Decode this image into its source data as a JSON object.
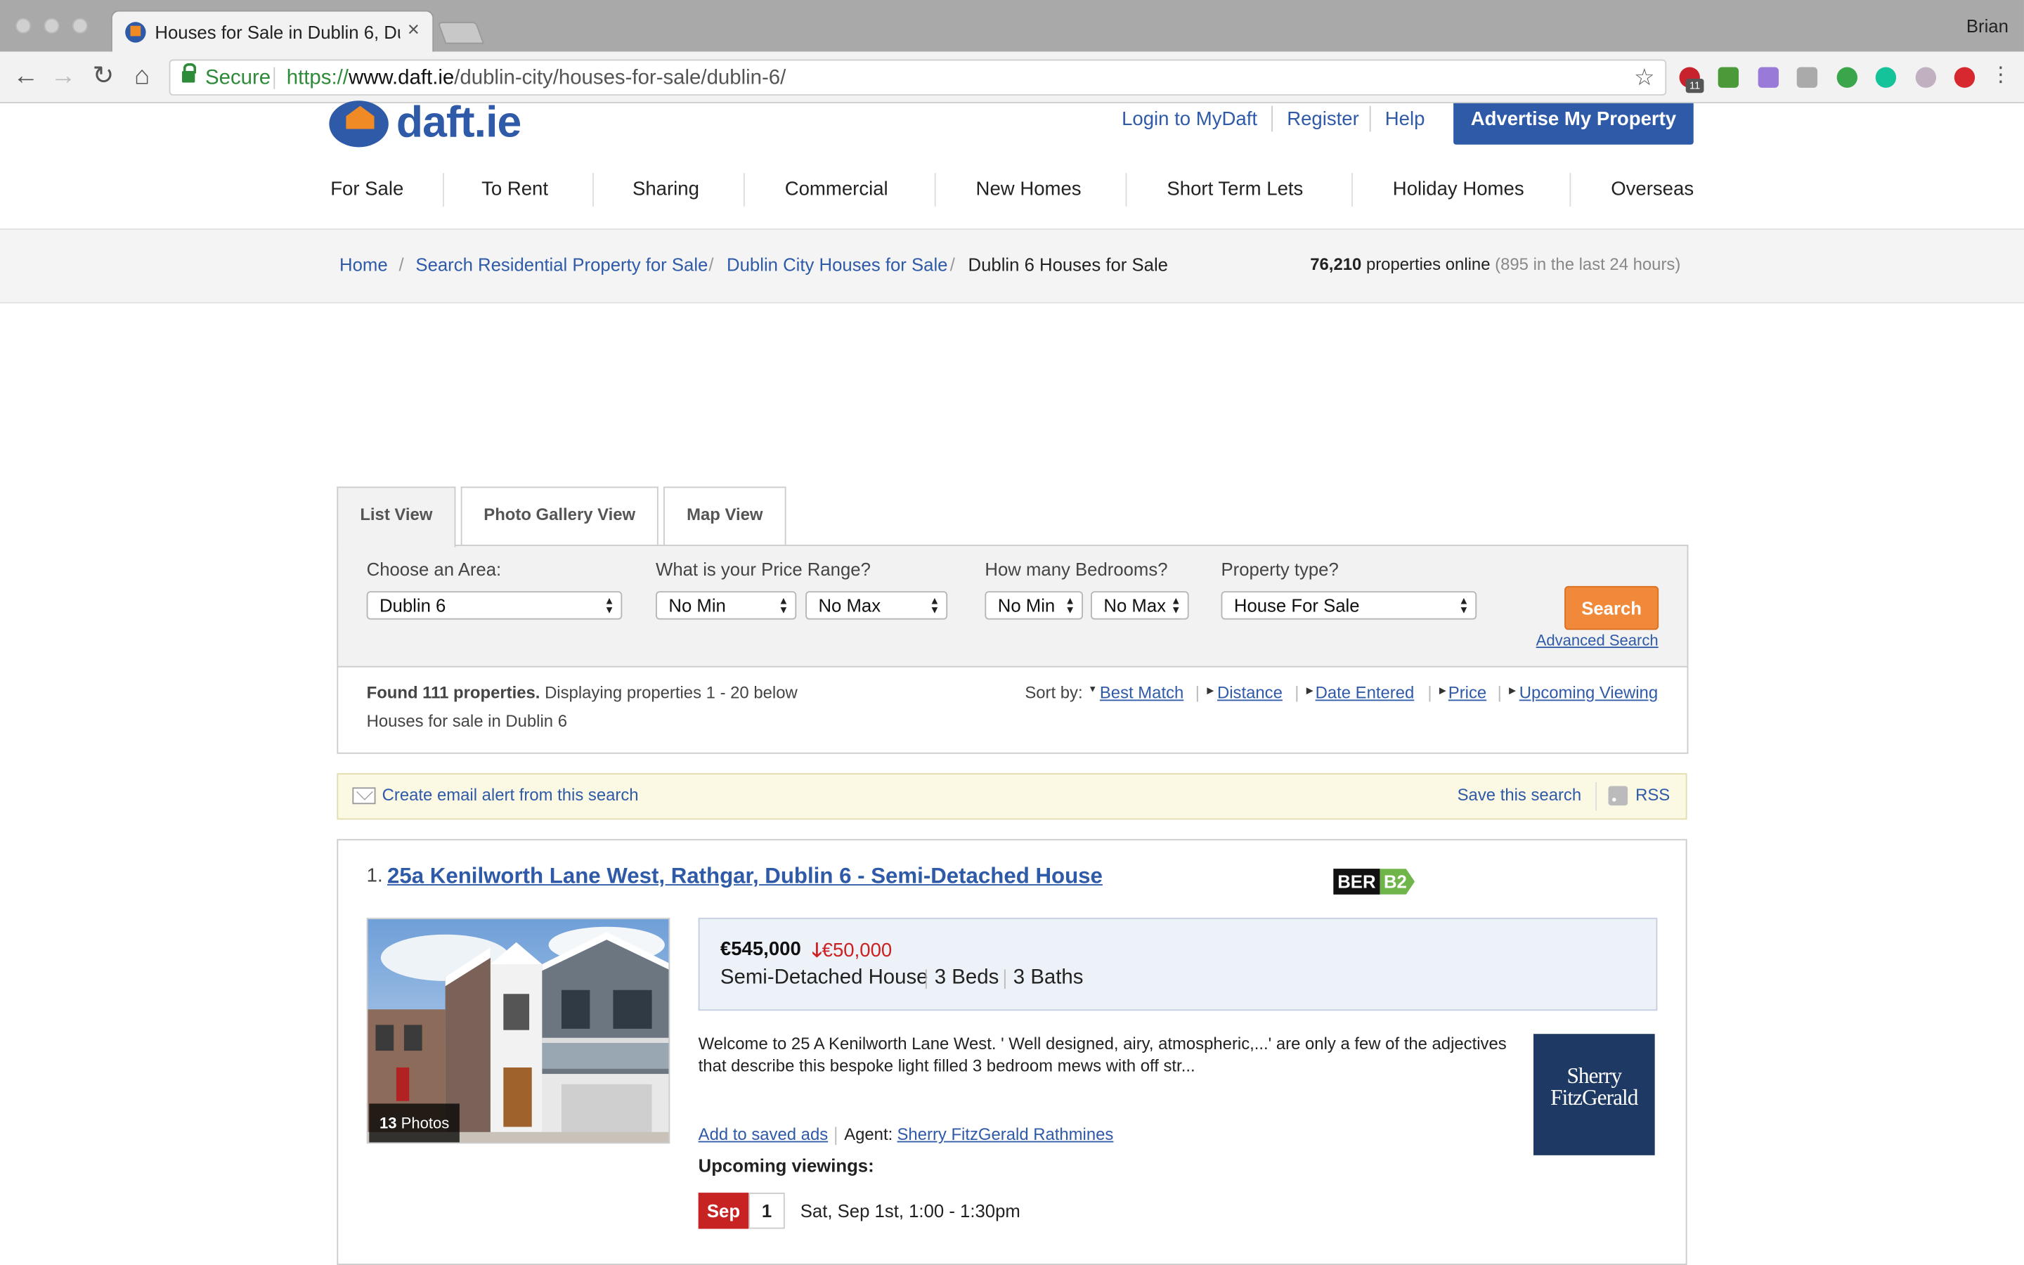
{
  "browser": {
    "tab_title": "Houses for Sale in Dublin 6, Du",
    "tab_close": "×",
    "profile_name": "Brian",
    "secure_label": "Secure",
    "url_scheme": "https://",
    "url_host": "www.daft.ie",
    "url_path": "/dublin-city/houses-for-sale/dublin-6/",
    "nav_icons": [
      "back-arrow-icon",
      "forward-arrow-icon",
      "reload-icon",
      "home-icon"
    ],
    "extension_icons": [
      "adblock-icon",
      "html-icon",
      "extension-icon",
      "pen-icon",
      "evernote-icon",
      "grammarly-icon",
      "glasses-icon",
      "shield-icon",
      "menu-dots-icon"
    ],
    "extension_badge": "11"
  },
  "header": {
    "logo_text": "daft.ie",
    "links": [
      "Login to MyDaft",
      "Register",
      "Help"
    ],
    "advertise_label": "Advertise My Property",
    "brand_color": "#2e5aa8",
    "accent_color": "#f08a24"
  },
  "main_nav": [
    "For Sale",
    "To Rent",
    "Sharing",
    "Commercial",
    "New Homes",
    "Short Term Lets",
    "Holiday Homes",
    "Overseas"
  ],
  "breadcrumb": {
    "items": [
      "Home",
      "Search Residential Property for Sale",
      "Dublin City Houses for Sale",
      "Dublin 6 Houses for Sale"
    ],
    "separator": "/"
  },
  "stats": {
    "count": "76,210",
    "count_suffix": "properties online",
    "recent": "(895 in the last 24 hours)"
  },
  "view_tabs": [
    "List View",
    "Photo Gallery View",
    "Map View"
  ],
  "search": {
    "area_label": "Choose an Area:",
    "area_value": "Dublin 6",
    "price_label": "What is your Price Range?",
    "price_min": "No Min",
    "price_max": "No Max",
    "beds_label": "How many Bedrooms?",
    "beds_min": "No Min",
    "beds_max": "No Max",
    "type_label": "Property type?",
    "type_value": "House For Sale",
    "search_button": "Search",
    "advanced_link": "Advanced Search"
  },
  "results": {
    "found_bold": "Found 111 properties.",
    "found_rest": " Displaying properties 1 - 20 below",
    "subtitle": "Houses for sale in Dublin 6",
    "sort_label": "Sort by:",
    "sort_options": [
      "Best Match",
      "Distance",
      "Date Entered",
      "Price",
      "Upcoming Viewing"
    ]
  },
  "alerts": {
    "email_alert": "Create email alert from this search",
    "save_search": "Save this search",
    "rss": "RSS"
  },
  "listing": {
    "number": "1.",
    "title": "25a Kenilworth Lane West, Rathgar, Dublin 6 - Semi-Detached House",
    "ber_label": "BER",
    "ber_grade": "B2",
    "photo_count_num": "13",
    "photo_count_label": " Photos",
    "price": "€545,000",
    "price_drop_arrow": "🡓",
    "price_drop": "€50,000",
    "property_type": "Semi-Detached House",
    "beds": "3 Beds",
    "baths": "3 Baths",
    "description": "Welcome to 25 A Kenilworth Lane West. ' Well designed, airy, atmospheric,...' are only a few of the adjectives that describe this bespoke light filled 3 bedroom mews with off str...",
    "save_link": "Add to saved ads",
    "agent_label": "Agent:",
    "agent_name": "Sherry FitzGerald Rathmines",
    "agent_logo_line1": "Sherry",
    "agent_logo_line2": "FitzGerald",
    "viewings_heading": "Upcoming viewings:",
    "viewing_month": "Sep",
    "viewing_day": "1",
    "viewing_time": "Sat, Sep 1st, 1:00 - 1:30pm"
  }
}
